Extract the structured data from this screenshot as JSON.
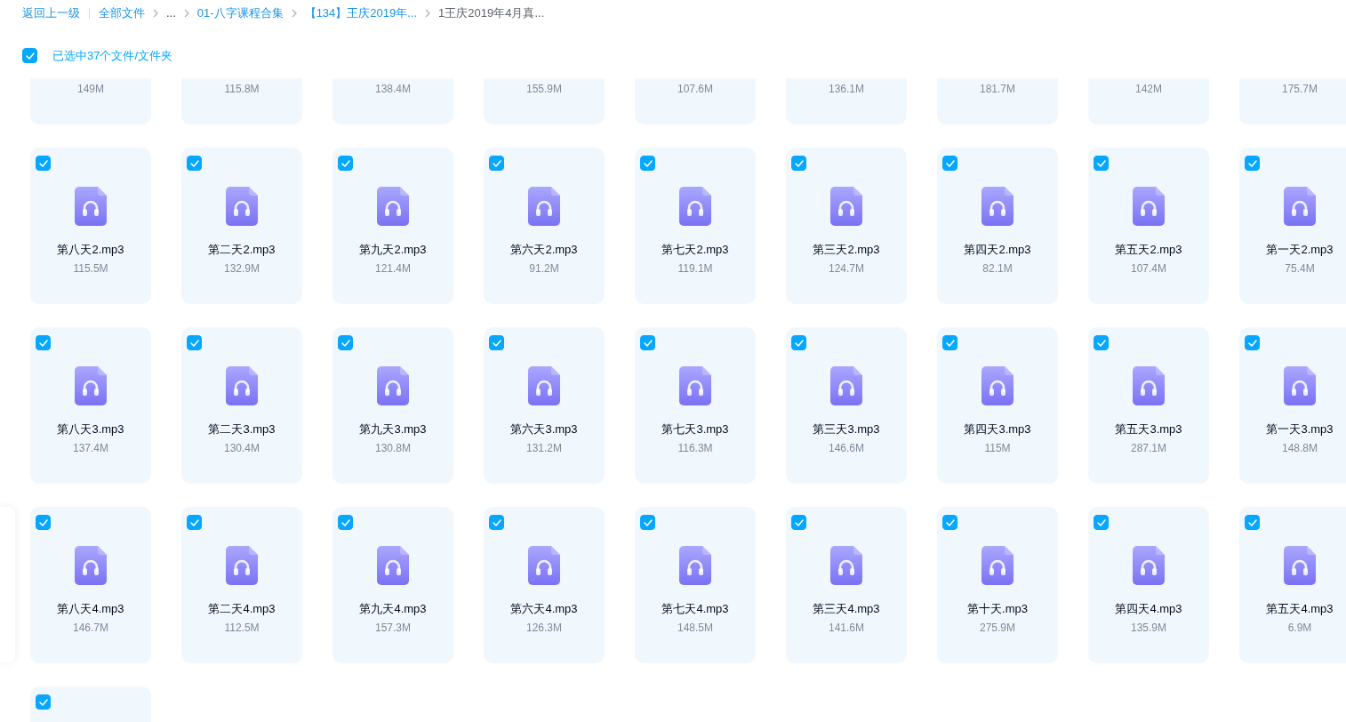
{
  "back_link": "返回上一级",
  "breadcrumb": [
    {
      "label": "全部文件",
      "kind": "link"
    },
    {
      "label": "...",
      "kind": "more"
    },
    {
      "label": "01-八字课程合集",
      "kind": "link"
    },
    {
      "label": "【134】王庆2019年...",
      "kind": "link"
    },
    {
      "label": "1王庆2019年4月真...",
      "kind": "current"
    }
  ],
  "selection": {
    "checked": true,
    "label": "已选中37个文件/文件夹"
  },
  "files": [
    {
      "size": "149M"
    },
    {
      "size": "115.8M"
    },
    {
      "size": "138.4M"
    },
    {
      "size": "155.9M"
    },
    {
      "size": "107.6M"
    },
    {
      "size": "136.1M"
    },
    {
      "size": "181.7M"
    },
    {
      "size": "142M"
    },
    {
      "size": "175.7M"
    },
    {
      "name": "第八天2.mp3",
      "size": "115.5M",
      "selected": true
    },
    {
      "name": "第二天2.mp3",
      "size": "132.9M",
      "selected": true
    },
    {
      "name": "第九天2.mp3",
      "size": "121.4M",
      "selected": true
    },
    {
      "name": "第六天2.mp3",
      "size": "91.2M",
      "selected": true
    },
    {
      "name": "第七天2.mp3",
      "size": "119.1M",
      "selected": true
    },
    {
      "name": "第三天2.mp3",
      "size": "124.7M",
      "selected": true
    },
    {
      "name": "第四天2.mp3",
      "size": "82.1M",
      "selected": true
    },
    {
      "name": "第五天2.mp3",
      "size": "107.4M",
      "selected": true
    },
    {
      "name": "第一天2.mp3",
      "size": "75.4M",
      "selected": true
    },
    {
      "name": "第八天3.mp3",
      "size": "137.4M",
      "selected": true
    },
    {
      "name": "第二天3.mp3",
      "size": "130.4M",
      "selected": true
    },
    {
      "name": "第九天3.mp3",
      "size": "130.8M",
      "selected": true
    },
    {
      "name": "第六天3.mp3",
      "size": "131.2M",
      "selected": true
    },
    {
      "name": "第七天3.mp3",
      "size": "116.3M",
      "selected": true
    },
    {
      "name": "第三天3.mp3",
      "size": "146.6M",
      "selected": true
    },
    {
      "name": "第四天3.mp3",
      "size": "115M",
      "selected": true
    },
    {
      "name": "第五天3.mp3",
      "size": "287.1M",
      "selected": true
    },
    {
      "name": "第一天3.mp3",
      "size": "148.8M",
      "selected": true
    },
    {
      "name": "第八天4.mp3",
      "size": "146.7M",
      "selected": true
    },
    {
      "name": "第二天4.mp3",
      "size": "112.5M",
      "selected": true
    },
    {
      "name": "第九天4.mp3",
      "size": "157.3M",
      "selected": true
    },
    {
      "name": "第六天4.mp3",
      "size": "126.3M",
      "selected": true
    },
    {
      "name": "第七天4.mp3",
      "size": "148.5M",
      "selected": true
    },
    {
      "name": "第三天4.mp3",
      "size": "141.6M",
      "selected": true
    },
    {
      "name": "第十天.mp3",
      "size": "275.9M",
      "selected": true
    },
    {
      "name": "第四天4.mp3",
      "size": "135.9M",
      "selected": true
    },
    {
      "name": "第五天4.mp3",
      "size": "6.9M",
      "selected": true
    },
    {
      "selected": true
    }
  ]
}
